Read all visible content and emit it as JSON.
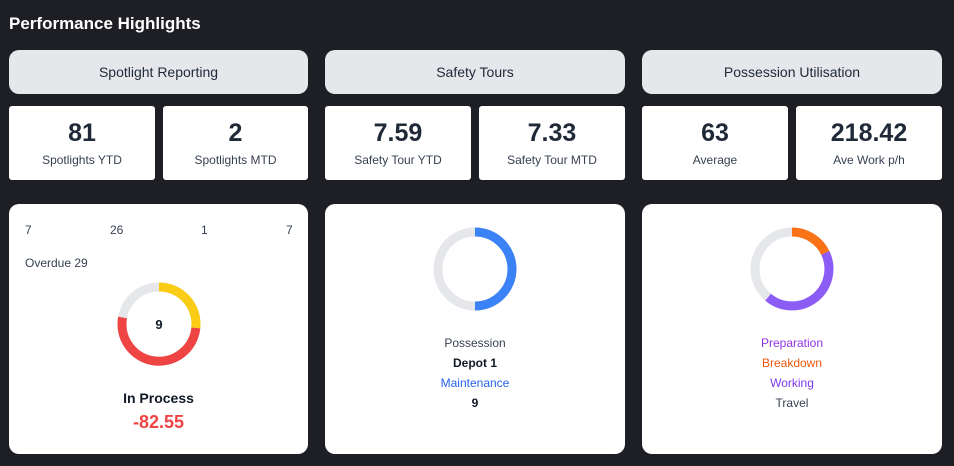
{
  "title": "Performance Highlights",
  "sections": [
    {
      "label": "Spotlight Reporting"
    },
    {
      "label": "Safety Tours"
    },
    {
      "label": "Possession Utilisation"
    }
  ],
  "stats": [
    {
      "value": "81",
      "label": "Spotlights YTD"
    },
    {
      "value": "2",
      "label": "Spotlights MTD"
    },
    {
      "value": "7.59",
      "label": "Safety Tour YTD"
    },
    {
      "value": "7.33",
      "label": "Safety Tour MTD"
    },
    {
      "value": "63",
      "label": "Average"
    },
    {
      "value": "218.42",
      "label": "Ave Work p/h"
    }
  ],
  "spotlight_card": {
    "counts": [
      "7",
      "26",
      "1",
      "7"
    ],
    "overdue": "Overdue 29",
    "donut_center": "9",
    "status": "In Process",
    "delta": "-82.55",
    "colors": {
      "track": "#e5e7eb",
      "yellow": "#facc15",
      "red": "#ef4444",
      "delta": "#ef4444"
    }
  },
  "safety_card": {
    "line1": "Possession",
    "line2": "Depot 1",
    "line3": "Maintenance",
    "line4": "9",
    "colors": {
      "track": "#e5e7eb",
      "blue": "#3b82f6"
    }
  },
  "possession_card": {
    "items": [
      {
        "label": "Preparation",
        "color": "#9333ea"
      },
      {
        "label": "Breakdown",
        "color": "#ea580c"
      },
      {
        "label": "Working",
        "color": "#7c3aed"
      },
      {
        "label": "Travel",
        "color": "#374151"
      }
    ],
    "colors": {
      "track": "#e5e7eb",
      "orange": "#f97316",
      "purple": "#8b5cf6"
    }
  }
}
